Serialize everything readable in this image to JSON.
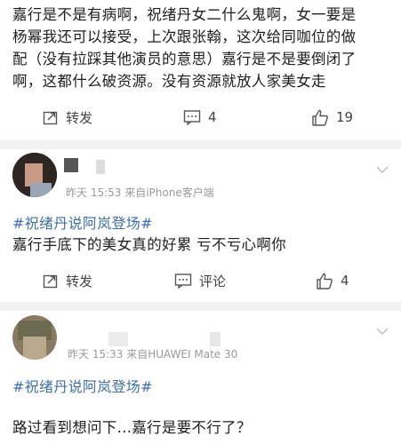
{
  "post": {
    "lines": [
      "嘉行是不是有病啊，祝绪丹女二什么鬼啊，女一要是",
      "杨幂我还可以接受，上次跟张翰，这次给同咖位的做",
      "配（没有拉踩其他演员的意思）嘉行是不是要倒闭了",
      "啊，这都什么破资源。没有资源就放人家美女走"
    ],
    "actions": {
      "repost": "转发",
      "comments": "4",
      "likes": "19"
    }
  },
  "comments": [
    {
      "meta": "昨天 15:53  来自iPhone客户端",
      "topic": "#祝绪丹说阿岚登场#",
      "text": "嘉行手底下的美女真的好累 亏不亏心啊你",
      "actions": {
        "repost": "转发",
        "comment": "评论",
        "likes": "4"
      }
    },
    {
      "meta": "昨天 15:33  来自HUAWEI Mate 30",
      "topic": "#祝绪丹说阿岚登场#",
      "text": "路过看到想问下...嘉行是要不行了？"
    }
  ],
  "icons": {
    "repost": "share-icon",
    "comment": "comment-icon",
    "like": "thumbs-up-icon",
    "chevron": "chevron-down-icon"
  },
  "colors": {
    "topic": "#3f6fa8",
    "divider": "#f2f2f2",
    "meta": "#999999"
  }
}
